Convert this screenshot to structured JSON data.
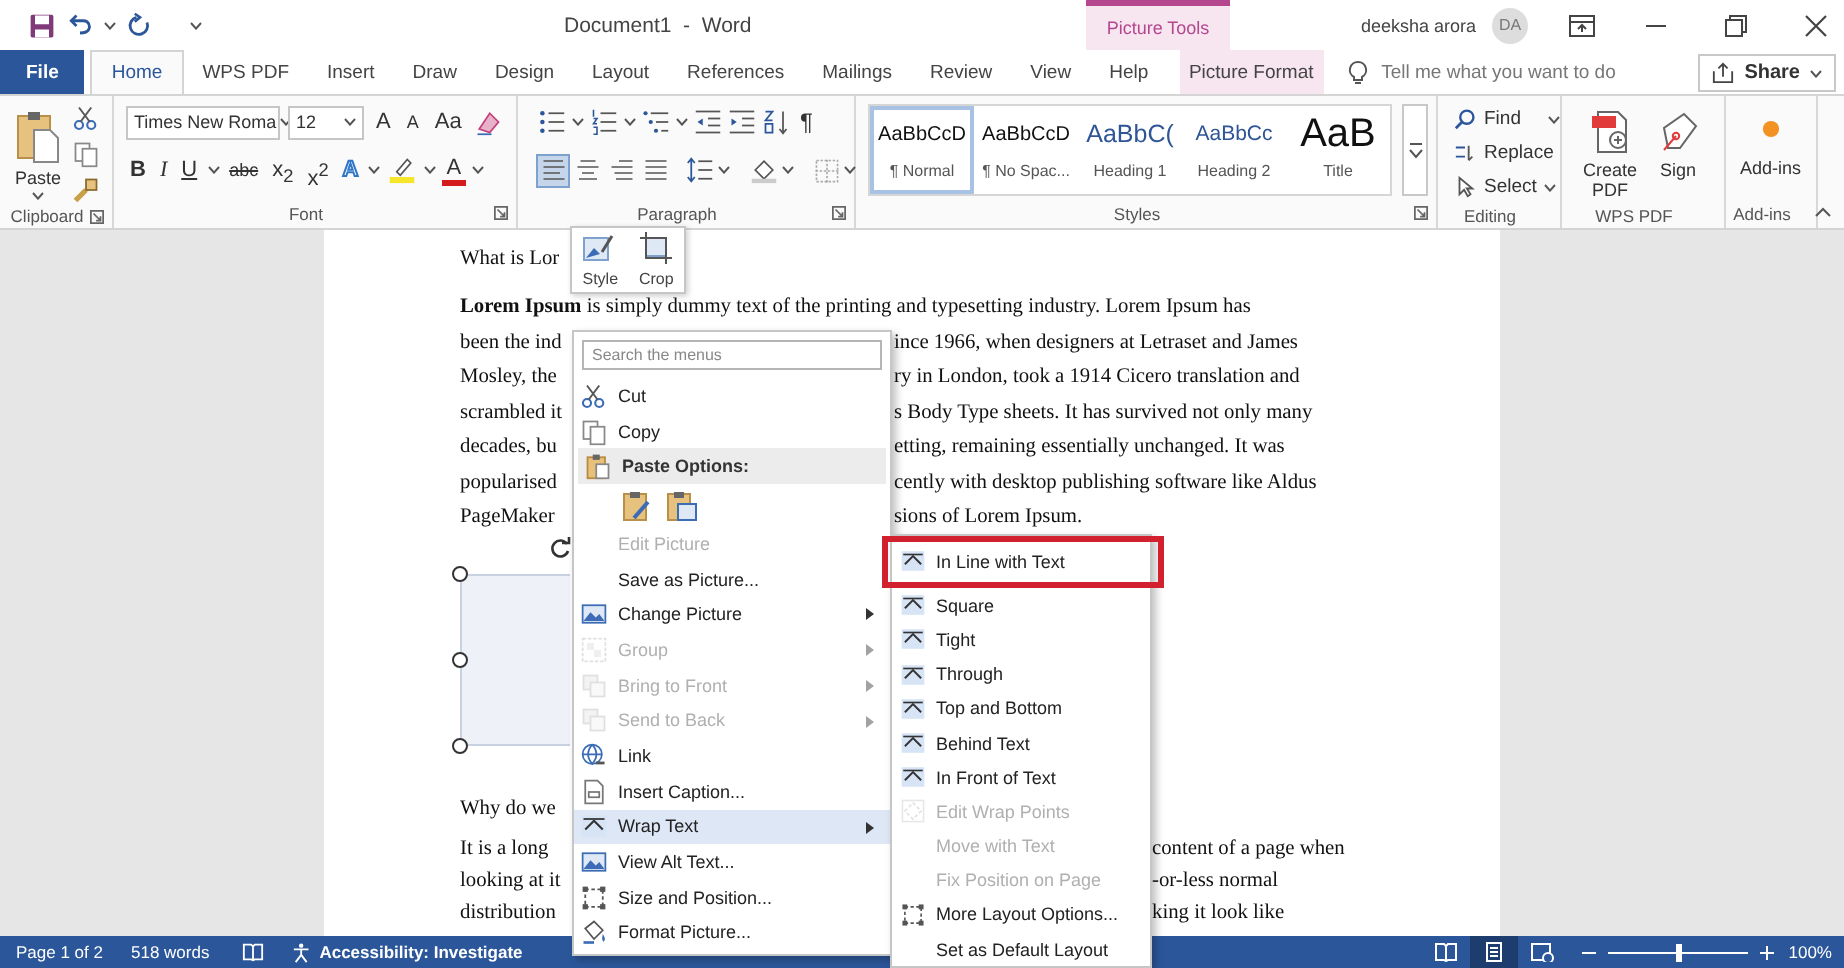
{
  "title_bar": {
    "title": "Document1  -  Word",
    "context_group": "Picture Tools",
    "user_name": "deeksha arora",
    "user_initials": "DA"
  },
  "tabs": [
    {
      "label": "File",
      "kind": "file",
      "selected": false
    },
    {
      "label": "Home",
      "kind": "normal",
      "selected": true
    },
    {
      "label": "WPS PDF",
      "kind": "normal",
      "selected": false
    },
    {
      "label": "Insert",
      "kind": "normal",
      "selected": false
    },
    {
      "label": "Draw",
      "kind": "normal",
      "selected": false
    },
    {
      "label": "Design",
      "kind": "normal",
      "selected": false
    },
    {
      "label": "Layout",
      "kind": "normal",
      "selected": false
    },
    {
      "label": "References",
      "kind": "normal",
      "selected": false
    },
    {
      "label": "Mailings",
      "kind": "normal",
      "selected": false
    },
    {
      "label": "Review",
      "kind": "normal",
      "selected": false
    },
    {
      "label": "View",
      "kind": "normal",
      "selected": false
    },
    {
      "label": "Help",
      "kind": "normal",
      "selected": false
    },
    {
      "label": "Picture Format",
      "kind": "context",
      "selected": false
    }
  ],
  "tell_me": {
    "placeholder": "Tell me what you want to do"
  },
  "share_button": "Share",
  "ribbon": {
    "clipboard": {
      "label": "Clipboard",
      "paste": "Paste"
    },
    "font": {
      "label": "Font",
      "font_name": "Times New Roma",
      "font_size": "12",
      "row1": [
        "A",
        "A",
        "Aa"
      ],
      "row2": [
        "B",
        "I",
        "U",
        "abc",
        "x$_{2}$",
        "x$^{2}$",
        "A",
        "A"
      ]
    },
    "paragraph": {
      "label": "Paragraph",
      "pilcrow": "¶",
      "alignments": [
        {
          "selected": true
        },
        {
          "selected": false
        },
        {
          "selected": false
        },
        {
          "selected": false
        }
      ]
    },
    "styles": {
      "label": "Styles",
      "items": [
        {
          "preview": "AaBbCcD",
          "name": "¶ Normal",
          "kind": "body",
          "selected": true
        },
        {
          "preview": "AaBbCcD",
          "name": "¶ No Spac...",
          "kind": "body",
          "selected": false
        },
        {
          "preview": "AaBbC(",
          "name": "Heading 1",
          "kind": "heading1",
          "selected": false
        },
        {
          "preview": "AaBbCc",
          "name": "Heading 2",
          "kind": "heading2",
          "selected": false
        },
        {
          "preview": "AaB",
          "name": "Title",
          "kind": "title",
          "selected": false
        }
      ]
    },
    "editing": {
      "label": "Editing",
      "find": "Find",
      "replace": "Replace",
      "select": "Select"
    },
    "wps_pdf": {
      "label": "WPS PDF",
      "create_pdf": "Create PDF",
      "sign": "Sign"
    },
    "add_ins": {
      "label": "Add-ins",
      "button": "Add-ins"
    }
  },
  "mini_toolbar": [
    "Style",
    "Crop"
  ],
  "document": {
    "paragraphs": [
      {
        "lines": [
          {
            "left": "What is Lor"
          }
        ]
      },
      {
        "lines": [
          {
            "left": "**Lorem Ipsum** is simply dummy text of the printing and typesetting industry. Lorem Ipsum has"
          },
          {
            "left": "been the ind",
            "right": "ince 1966, when designers at Letraset and James"
          },
          {
            "left": "Mosley, the",
            "right": "ry in London, took a 1914 Cicero translation and"
          },
          {
            "left": "scrambled it",
            "right": "s Body Type sheets. It has survived not only many"
          },
          {
            "left": "decades, bu",
            "right": "etting, remaining essentially unchanged. It was"
          },
          {
            "left": "popularised",
            "right": "cently with desktop publishing software like Aldus"
          },
          {
            "left": "PageMaker",
            "right": "sions of Lorem Ipsum."
          }
        ]
      },
      {
        "lines": [
          {
            "left": "Why do we"
          }
        ]
      },
      {
        "lines": [
          {
            "left": "It is a long",
            "right": "content of a page when"
          },
          {
            "left": "looking at it",
            "right": "-or-less normal"
          },
          {
            "left": "distribution",
            "right": "king it look like"
          }
        ]
      }
    ]
  },
  "context_menu": {
    "search": {
      "placeholder": "Search the menus"
    },
    "items": [
      {
        "kind": "item",
        "label": "Cut",
        "disabled": false,
        "highlighted": false,
        "submenu": false
      },
      {
        "kind": "item",
        "label": "Copy",
        "disabled": false,
        "highlighted": false,
        "submenu": false
      },
      {
        "kind": "header",
        "label": "Paste Options:"
      },
      {
        "kind": "paste_icons"
      },
      {
        "kind": "item",
        "label": "Edit Picture",
        "disabled": true,
        "highlighted": false,
        "submenu": false
      },
      {
        "kind": "item",
        "label": "Save as Picture...",
        "disabled": false,
        "highlighted": false,
        "submenu": false
      },
      {
        "kind": "item",
        "label": "Change Picture",
        "disabled": false,
        "highlighted": false,
        "submenu": true
      },
      {
        "kind": "item",
        "label": "Group",
        "disabled": true,
        "highlighted": false,
        "submenu": true
      },
      {
        "kind": "item",
        "label": "Bring to Front",
        "disabled": true,
        "highlighted": false,
        "submenu": true
      },
      {
        "kind": "item",
        "label": "Send to Back",
        "disabled": true,
        "highlighted": false,
        "submenu": true
      },
      {
        "kind": "item",
        "label": "Link",
        "disabled": false,
        "highlighted": false,
        "submenu": false
      },
      {
        "kind": "item",
        "label": "Insert Caption...",
        "disabled": false,
        "highlighted": false,
        "submenu": false
      },
      {
        "kind": "item",
        "label": "Wrap Text",
        "disabled": false,
        "highlighted": true,
        "submenu": true
      },
      {
        "kind": "item",
        "label": "View Alt Text...",
        "disabled": false,
        "highlighted": false,
        "submenu": false
      },
      {
        "kind": "item",
        "label": "Size and Position...",
        "disabled": false,
        "highlighted": false,
        "submenu": false
      },
      {
        "kind": "item",
        "label": "Format Picture...",
        "disabled": false,
        "highlighted": false,
        "submenu": false
      }
    ]
  },
  "wrap_submenu": {
    "items": [
      {
        "label": "In Line with Text",
        "disabled": false,
        "annotated": true
      },
      {
        "label": "Square",
        "disabled": false,
        "annotated": false
      },
      {
        "label": "Tight",
        "disabled": false,
        "annotated": false
      },
      {
        "label": "Through",
        "disabled": false,
        "annotated": false
      },
      {
        "label": "Top and Bottom",
        "disabled": false,
        "annotated": false
      },
      {
        "label": "Behind Text",
        "disabled": false,
        "annotated": false
      },
      {
        "label": "In Front of Text",
        "disabled": false,
        "annotated": false
      },
      {
        "label": "Edit Wrap Points",
        "disabled": true,
        "annotated": false
      },
      {
        "label": "Move with Text",
        "disabled": true,
        "annotated": false
      },
      {
        "label": "Fix Position on Page",
        "disabled": true,
        "annotated": false
      },
      {
        "label": "More Layout Options...",
        "disabled": false,
        "annotated": false
      },
      {
        "label": "Set as Default Layout",
        "disabled": false,
        "annotated": false
      }
    ]
  },
  "status_bar": {
    "page": "Page 1 of 2",
    "words": "518 words",
    "accessibility": "Accessibility: Investigate",
    "views": [
      {
        "selected": false
      },
      {
        "selected": true
      },
      {
        "selected": false
      }
    ],
    "zoom": {
      "level": 0.5,
      "reading": "100%"
    }
  }
}
